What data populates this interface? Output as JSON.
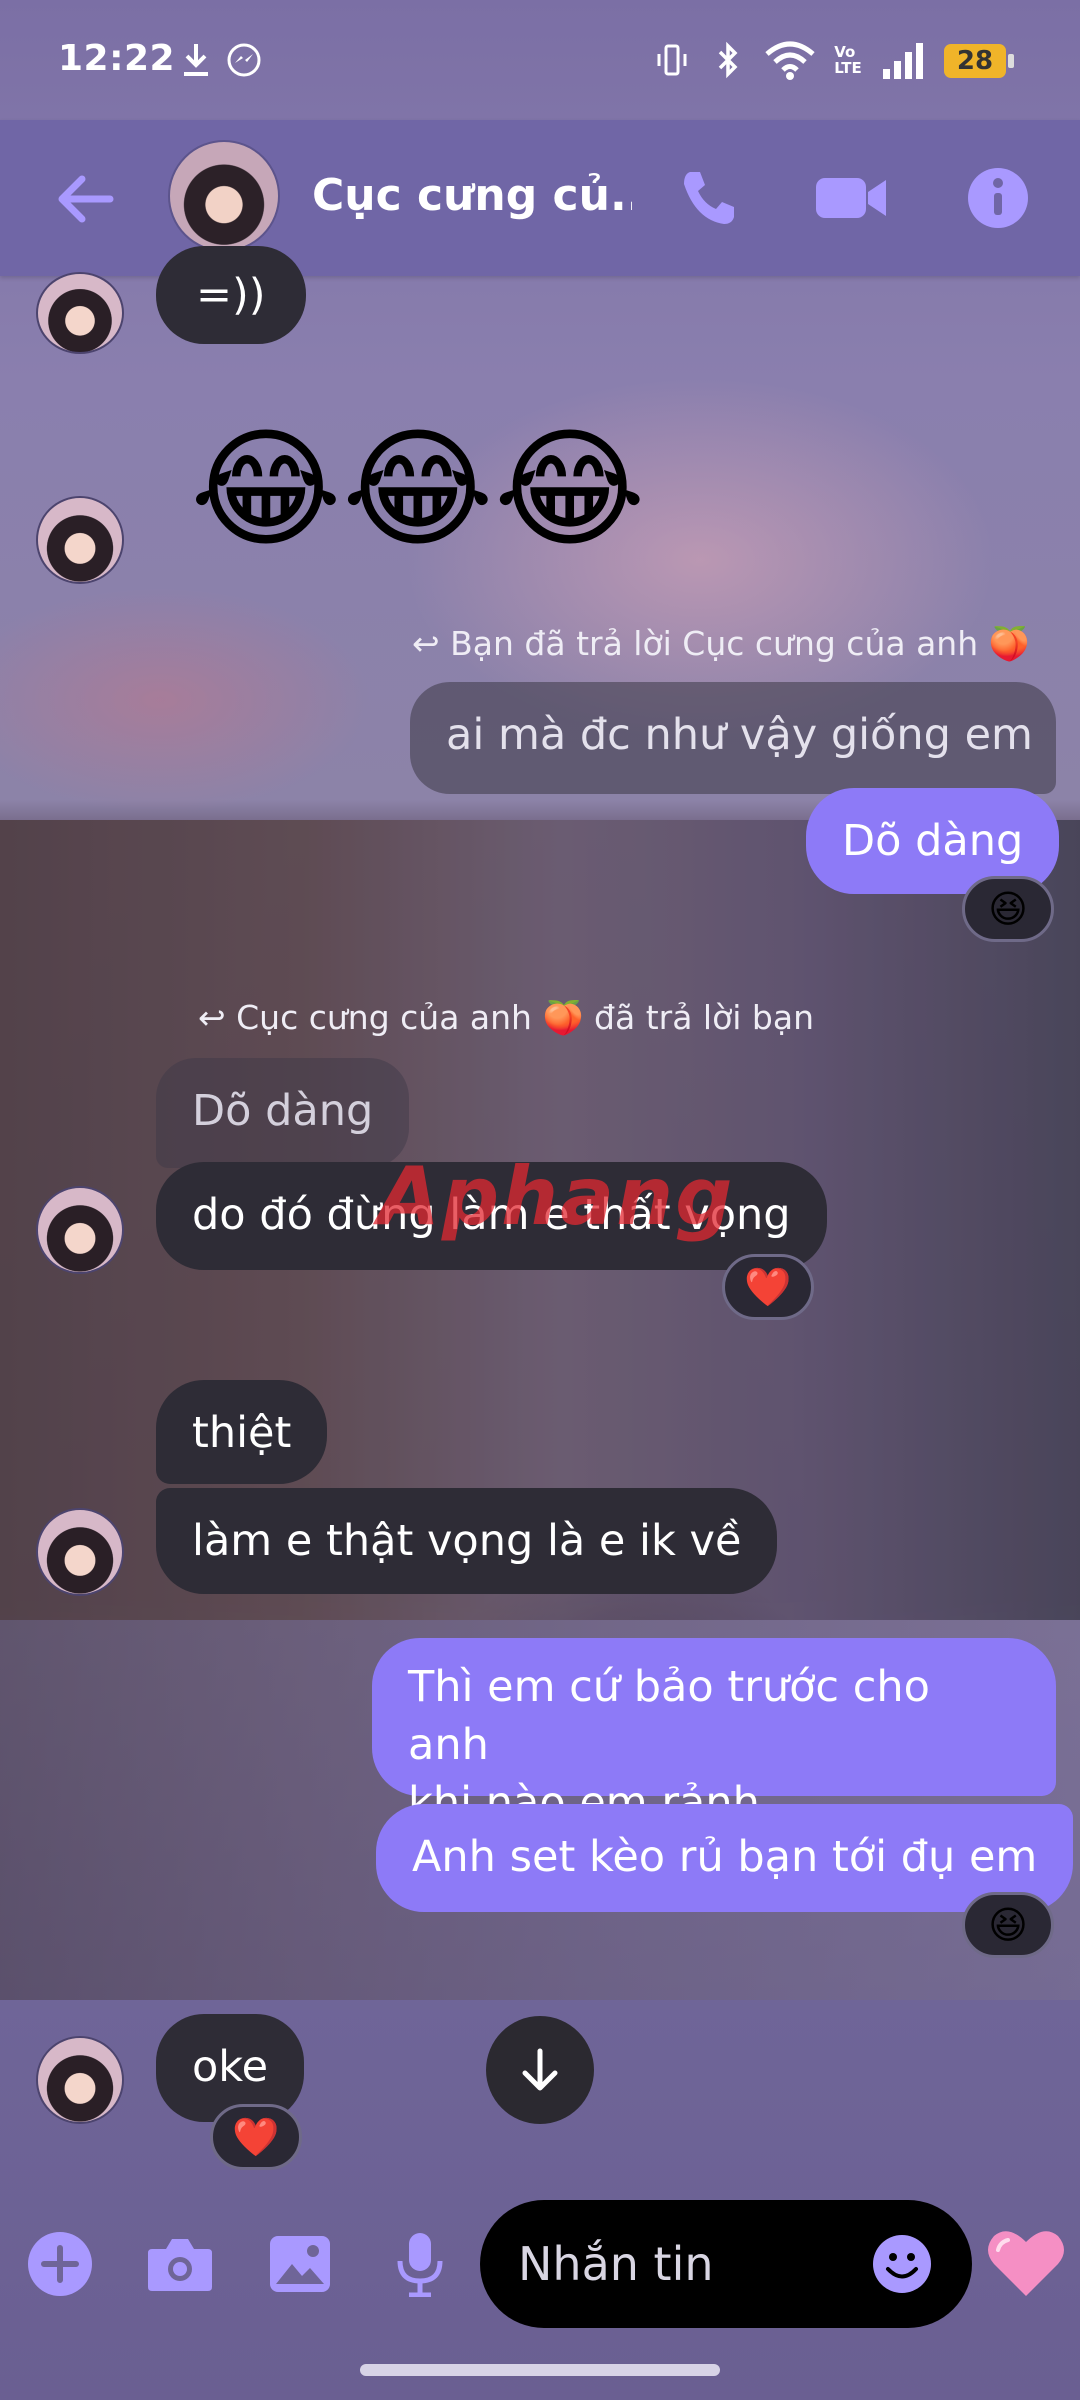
{
  "status_bar": {
    "time": "12:22",
    "battery": "28",
    "icons": [
      "download-icon",
      "messenger-icon",
      "vibrate-icon",
      "bluetooth-icon",
      "wifi-icon",
      "volte-icon",
      "signal-icon",
      "battery-icon"
    ]
  },
  "header": {
    "contact_name": "Cục cưng củ...",
    "icons": [
      "back-arrow-icon",
      "phone-icon",
      "video-camera-icon",
      "info-icon"
    ]
  },
  "messages": {
    "m1": "=))",
    "big_emoji": "😂😂😂",
    "reply_note_1": "Bạn đã trả lời Cục cưng của anh 🍑",
    "quoted_1": "ai mà đc như vậy giống em",
    "m2": "Dõ dàng",
    "react_m2": "😆",
    "reply_note_2": "Cục cưng của anh 🍑 đã trả lời bạn",
    "quoted_2": "Dõ dàng",
    "m3": "do đó đừng làm e thất vọng",
    "react_m3": "❤️",
    "m4": "thiệt",
    "m5": "làm e thật vọng là e ik về",
    "m6": "Thì em cứ bảo trước cho anh\nkhi nào em rảnh",
    "m7": "Anh set kèo rủ bạn tới đụ em",
    "react_m7": "😆",
    "m8": "oke",
    "react_m8": "❤️"
  },
  "watermark": "Aphang",
  "composer": {
    "placeholder": "Nhắn tin",
    "like_emoji": "🩷",
    "icons": [
      "plus-icon",
      "camera-icon",
      "gallery-icon",
      "microphone-icon",
      "emoji-icon",
      "heart-icon"
    ]
  },
  "colors": {
    "accent": "#8d7af7",
    "header_bg": "#7066a6",
    "received_bubble": "#2e2c36"
  }
}
